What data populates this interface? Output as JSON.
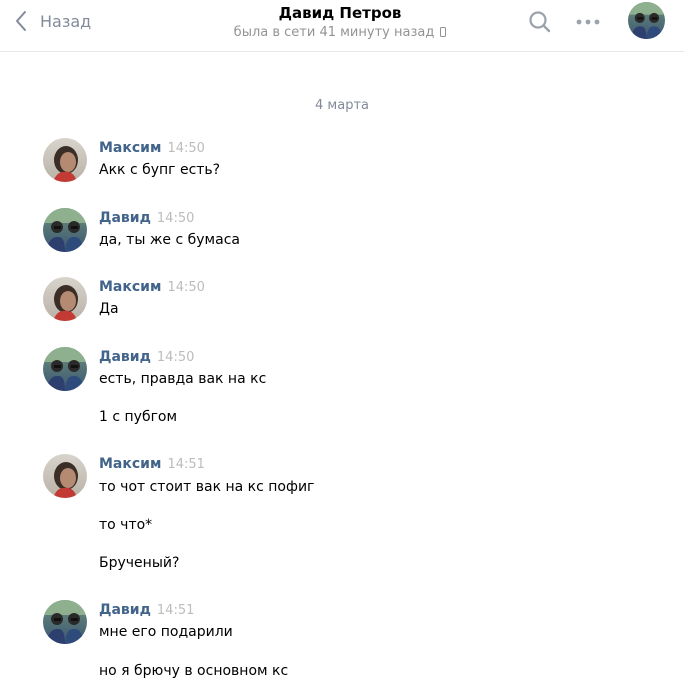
{
  "header": {
    "back_label": "Назад",
    "title": "Давид Петров",
    "status": "была в сети 41 минуту назад"
  },
  "chat": {
    "date": "4 марта",
    "messages": [
      {
        "author": "Максим",
        "time": "14:50",
        "lines": [
          "Акк с бупг есть?"
        ]
      },
      {
        "author": "Давид",
        "time": "14:50",
        "lines": [
          "да, ты же с бумаса"
        ]
      },
      {
        "author": "Максим",
        "time": "14:50",
        "lines": [
          "Да"
        ]
      },
      {
        "author": "Давид",
        "time": "14:50",
        "lines": [
          "есть, правда вак на кс",
          "1 с пубгом"
        ]
      },
      {
        "author": "Максим",
        "time": "14:51",
        "lines": [
          "то чот стоит вак на кс пофиг",
          "то что*",
          "Брученый?"
        ]
      },
      {
        "author": "Давид",
        "time": "14:51",
        "lines": [
          "мне его подарили",
          "но я брючу в основном кс"
        ]
      }
    ]
  },
  "colors": {
    "author": "#42648b",
    "time": "#bcbcbc",
    "secondary": "#828a99",
    "divider": "#e7e8ec"
  }
}
